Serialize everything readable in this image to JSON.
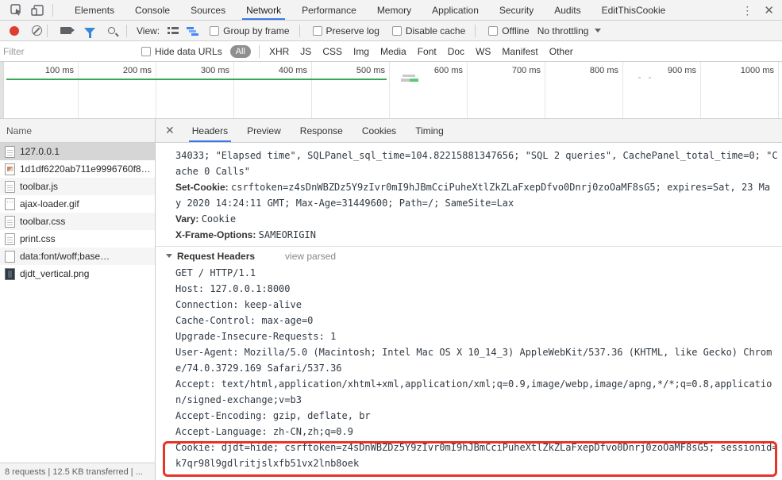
{
  "main_tabs": {
    "items": [
      {
        "label": "Elements"
      },
      {
        "label": "Console"
      },
      {
        "label": "Sources"
      },
      {
        "label": "Network"
      },
      {
        "label": "Performance"
      },
      {
        "label": "Memory"
      },
      {
        "label": "Application"
      },
      {
        "label": "Security"
      },
      {
        "label": "Audits"
      },
      {
        "label": "EditThisCookie"
      }
    ],
    "active": "Network",
    "kebab": "⋮",
    "close": "✕"
  },
  "toolbar": {
    "view_label": "View:",
    "group_by_frame": "Group by frame",
    "preserve_log": "Preserve log",
    "disable_cache": "Disable cache",
    "offline": "Offline",
    "throttling": "No throttling"
  },
  "filter_bar": {
    "placeholder": "Filter",
    "hide_data_urls": "Hide data URLs",
    "all": "All",
    "types": [
      "XHR",
      "JS",
      "CSS",
      "Img",
      "Media",
      "Font",
      "Doc",
      "WS",
      "Manifest",
      "Other"
    ]
  },
  "timeline": {
    "labels": [
      "100 ms",
      "200 ms",
      "300 ms",
      "400 ms",
      "500 ms",
      "600 ms",
      "700 ms",
      "800 ms",
      "900 ms",
      "1000 ms"
    ]
  },
  "files": {
    "header": "Name",
    "rows": [
      {
        "name": "127.0.0.1"
      },
      {
        "name": "1d1df6220ab711e9996760f8…"
      },
      {
        "name": "toolbar.js"
      },
      {
        "name": "ajax-loader.gif"
      },
      {
        "name": "toolbar.css"
      },
      {
        "name": "print.css"
      },
      {
        "name": "data:font/woff;base…"
      },
      {
        "name": "djdt_vertical.png"
      }
    ],
    "status": "8 requests | 12.5 KB transferred | ..."
  },
  "details": {
    "close": "✕",
    "tabs": [
      {
        "label": "Headers"
      },
      {
        "label": "Preview"
      },
      {
        "label": "Response"
      },
      {
        "label": "Cookies"
      },
      {
        "label": "Timing"
      }
    ],
    "active_tab": "Headers",
    "response": {
      "l1": "34033; \"Elapsed time\", SQLPanel_sql_time=104.82215881347656; \"SQL 2 queries\", CachePanel_total_time=0; \"C",
      "l2": "ache 0 Calls\"",
      "set_cookie_name": "Set-Cookie: ",
      "set_cookie_value": "csrftoken=z4sDnWBZDz5Y9zIvr0mI9hJBmCciPuheXtlZkZLaFxepDfvo0Dnrj0zoOaMF8sG5; expires=Sat, 23 Ma",
      "l4": "y 2020 14:24:11 GMT; Max-Age=31449600; Path=/; SameSite=Lax",
      "vary_name": "Vary: ",
      "vary_value": "Cookie",
      "xfo_name": "X-Frame-Options: ",
      "xfo_value": "SAMEORIGIN"
    },
    "request_section": {
      "title": "Request Headers",
      "view_parsed": "view parsed",
      "lines": [
        "GET / HTTP/1.1",
        "Host: 127.0.0.1:8000",
        "Connection: keep-alive",
        "Cache-Control: max-age=0",
        "Upgrade-Insecure-Requests: 1",
        "User-Agent: Mozilla/5.0 (Macintosh; Intel Mac OS X 10_14_3) AppleWebKit/537.36 (KHTML, like Gecko) Chrom",
        "e/74.0.3729.169 Safari/537.36",
        "Accept: text/html,application/xhtml+xml,application/xml;q=0.9,image/webp,image/apng,*/*;q=0.8,applicatio",
        "n/signed-exchange;v=b3",
        "Accept-Encoding: gzip, deflate, br",
        "Accept-Language: zh-CN,zh;q=0.9"
      ],
      "cookie_line1": "Cookie: djdt=hide; csrftoken=z4sDnWBZDz5Y9zIvr0mI9hJBmCciPuheXtlZkZLaFxepDfvo0Dnrj0zoOaMF8sG5; sessionid=",
      "cookie_line2": "k7qr98l9gdlritjslxfb51vx2lnb8oek"
    }
  },
  "colors": {
    "accent_blue": "#3b78e7",
    "record_red": "#df3d31",
    "filter_blue": "#3788d8",
    "timeline_green": "#36a852",
    "highlight_red": "#e8332a"
  }
}
